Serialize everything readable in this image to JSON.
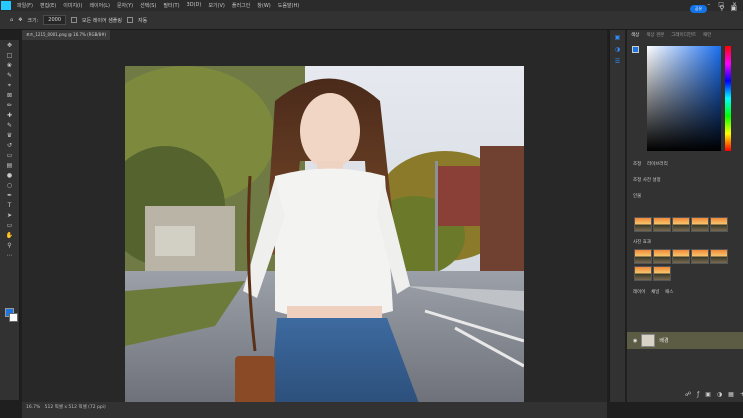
{
  "menubar": {
    "items": [
      "파일(F)",
      "편집(E)",
      "이미지(I)",
      "레이어(L)",
      "문자(Y)",
      "선택(S)",
      "필터(T)",
      "3D(D)",
      "보기(V)",
      "플러그인",
      "창(W)",
      "도움말(H)"
    ]
  },
  "options": {
    "size_label": "크기:",
    "size_value": "2000",
    "sample_all_label": "모든 레이어 샘플링",
    "auto_label": "자동",
    "share_label": "공유"
  },
  "document": {
    "tab_label": "포즈_1215_0001.png @ 16.7% (RGB/8#)"
  },
  "status": {
    "zoom": "16.7%",
    "info": "512 픽셀 x 512 픽셀 (72 ppi)"
  },
  "panels": {
    "color_tabs": [
      "색상",
      "색상 견본",
      "그레이디언트",
      "패턴"
    ],
    "props_tabs": [
      "조정",
      "라이브러리"
    ],
    "adjust_header": "조정 사전 설정",
    "group1_label": "인물",
    "group2_label": "사진 효과",
    "layers_tabs": [
      "레이어",
      "채널",
      "패스"
    ],
    "layer_name": "배경"
  },
  "colors": {
    "accent": "#1473e6",
    "foreground": "#1b76e0",
    "background": "#ffffff",
    "layer_selected": "#5c5c44"
  },
  "icons": {
    "home": "home-icon",
    "move": "move-icon",
    "zoom": "zoom-icon",
    "search": "search-icon",
    "settings": "gear-icon"
  }
}
